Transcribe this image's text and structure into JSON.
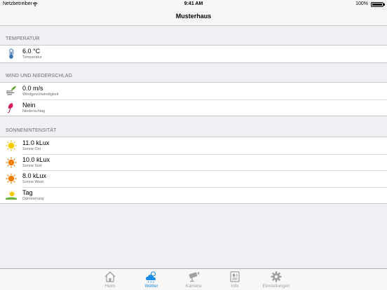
{
  "status_bar": {
    "carrier": "Netzbetreiber",
    "time": "9:41 AM",
    "battery": "100%"
  },
  "nav": {
    "title": "Musterhaus"
  },
  "sections": {
    "temperature": {
      "header": "TEMPERATUR",
      "rows": [
        {
          "value": "6.0 °C",
          "label": "Temperatur",
          "icon": "thermometer-icon"
        }
      ]
    },
    "wind": {
      "header": "WIND UND NIEDERSCHLAG",
      "rows": [
        {
          "value": "0.0 m/s",
          "label": "Windgeschwindigkeit",
          "icon": "wind-icon"
        },
        {
          "value": "Nein",
          "label": "Niederschlag",
          "icon": "umbrella-icon"
        }
      ]
    },
    "sun": {
      "header": "SONNENINTENSITÄT",
      "rows": [
        {
          "value": "11.0 kLux",
          "label": "Sonne Ost",
          "icon": "sun-yellow-icon"
        },
        {
          "value": "10.0 kLux",
          "label": "Sonne Süd",
          "icon": "sun-orange-icon"
        },
        {
          "value": "8.0 kLux",
          "label": "Sonne West",
          "icon": "sun-orange-icon"
        },
        {
          "value": "Tag",
          "label": "Dämmerung",
          "icon": "sunrise-icon"
        }
      ]
    }
  },
  "tabs": [
    {
      "label": "Heim",
      "icon": "home-icon",
      "active": false
    },
    {
      "label": "Wetter",
      "icon": "weather-icon",
      "active": true
    },
    {
      "label": "Kamera",
      "icon": "camera-icon",
      "active": false
    },
    {
      "label": "Info",
      "icon": "info-icon",
      "active": false
    },
    {
      "label": "Einstellungen",
      "icon": "gear-icon",
      "active": false
    }
  ],
  "colors": {
    "accent": "#1a8ce8",
    "tab_inactive": "#a0a0a0",
    "sun_yellow": "#f7c600",
    "sun_orange": "#ef7d00",
    "background": "#efeff4"
  }
}
